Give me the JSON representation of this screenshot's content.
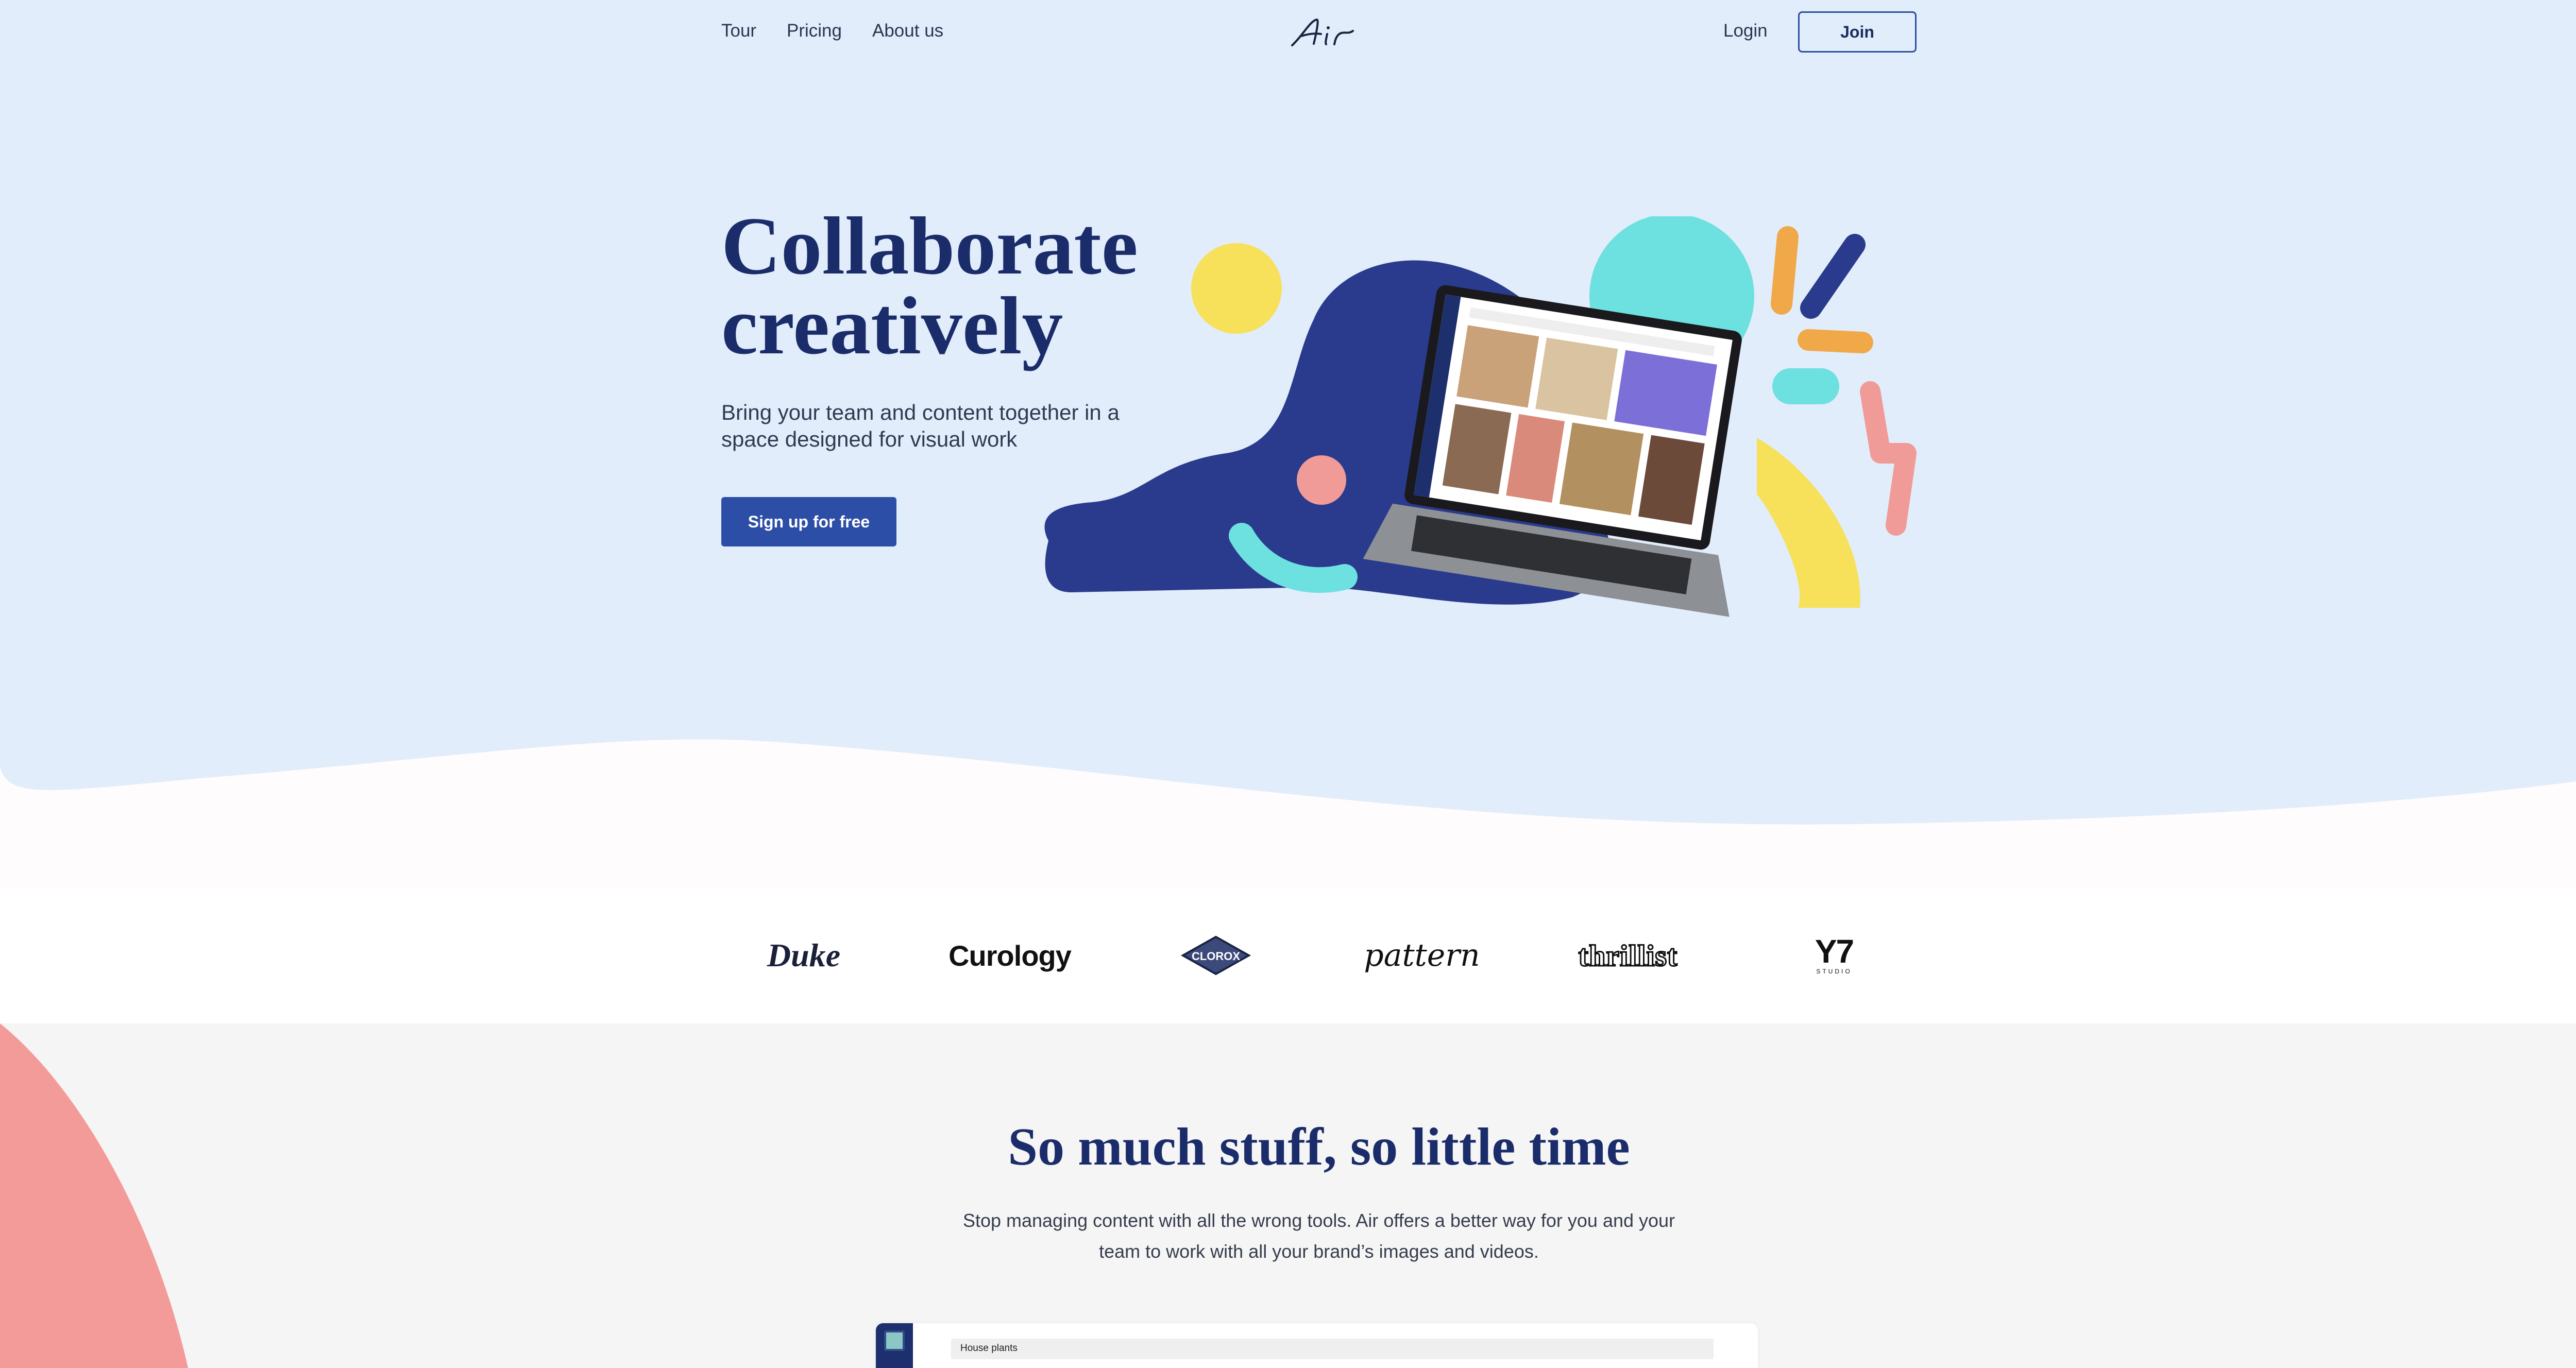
{
  "nav": {
    "links": [
      "Tour",
      "Pricing",
      "About us"
    ],
    "login": "Login",
    "join": "Join"
  },
  "hero": {
    "title_line1": "Collaborate",
    "title_line2": "creatively",
    "subtitle": "Bring your team and content together in a space designed for visual work",
    "cta": "Sign up for free"
  },
  "logos": {
    "duke": "Duke",
    "curology": "Curology",
    "clorox": "CLOROX",
    "pattern": "pattern",
    "thrillist": "thrillist",
    "y7": "Y7",
    "y7_sub": "STUDIO"
  },
  "section": {
    "title": "So much stuff, so little time",
    "subtitle": "Stop managing content with all the wrong tools. Air offers a better way for you and your team to work with all your brand’s images and videos."
  },
  "app_preview": {
    "board_title": "House plants"
  },
  "colors": {
    "hero_bg": "#e1edfa",
    "navy": "#1b2c6b",
    "cta_blue": "#2d4ea6",
    "yellow": "#f7e05a",
    "cyan": "#6de0e0",
    "pink": "#f09b98",
    "orange": "#f0a848",
    "blob_navy": "#2a3a8c"
  },
  "icons": {
    "logo": "air-logo",
    "clorox": "clorox-logo-icon"
  }
}
